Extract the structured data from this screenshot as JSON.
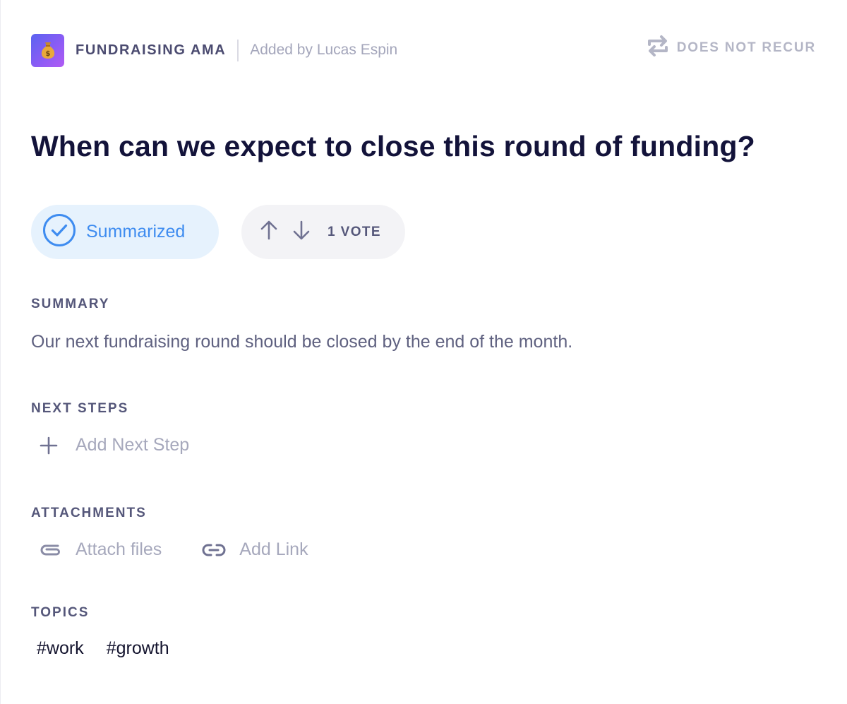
{
  "header": {
    "group_name": "FUNDRAISING AMA",
    "added_by": "Added by Lucas Espin",
    "recurrence": "DOES NOT RECUR",
    "app_icon": "money-bag-icon"
  },
  "question": {
    "title": "When can we expect to close this round of funding?"
  },
  "status": {
    "label": "Summarized",
    "color": "#3e8cf0"
  },
  "votes": {
    "label": "1 VOTE",
    "count": 1
  },
  "summary": {
    "heading": "SUMMARY",
    "text": "Our next fundraising round should be closed by the end of the month."
  },
  "next_steps": {
    "heading": "NEXT STEPS",
    "add_label": "Add Next Step"
  },
  "attachments": {
    "heading": "ATTACHMENTS",
    "attach_label": "Attach files",
    "link_label": "Add Link"
  },
  "topics": {
    "heading": "TOPICS",
    "items": [
      "#work",
      "#growth"
    ]
  },
  "colors": {
    "accent": "#3e8cf0",
    "title": "#13133a",
    "muted": "#a6a8bc"
  }
}
